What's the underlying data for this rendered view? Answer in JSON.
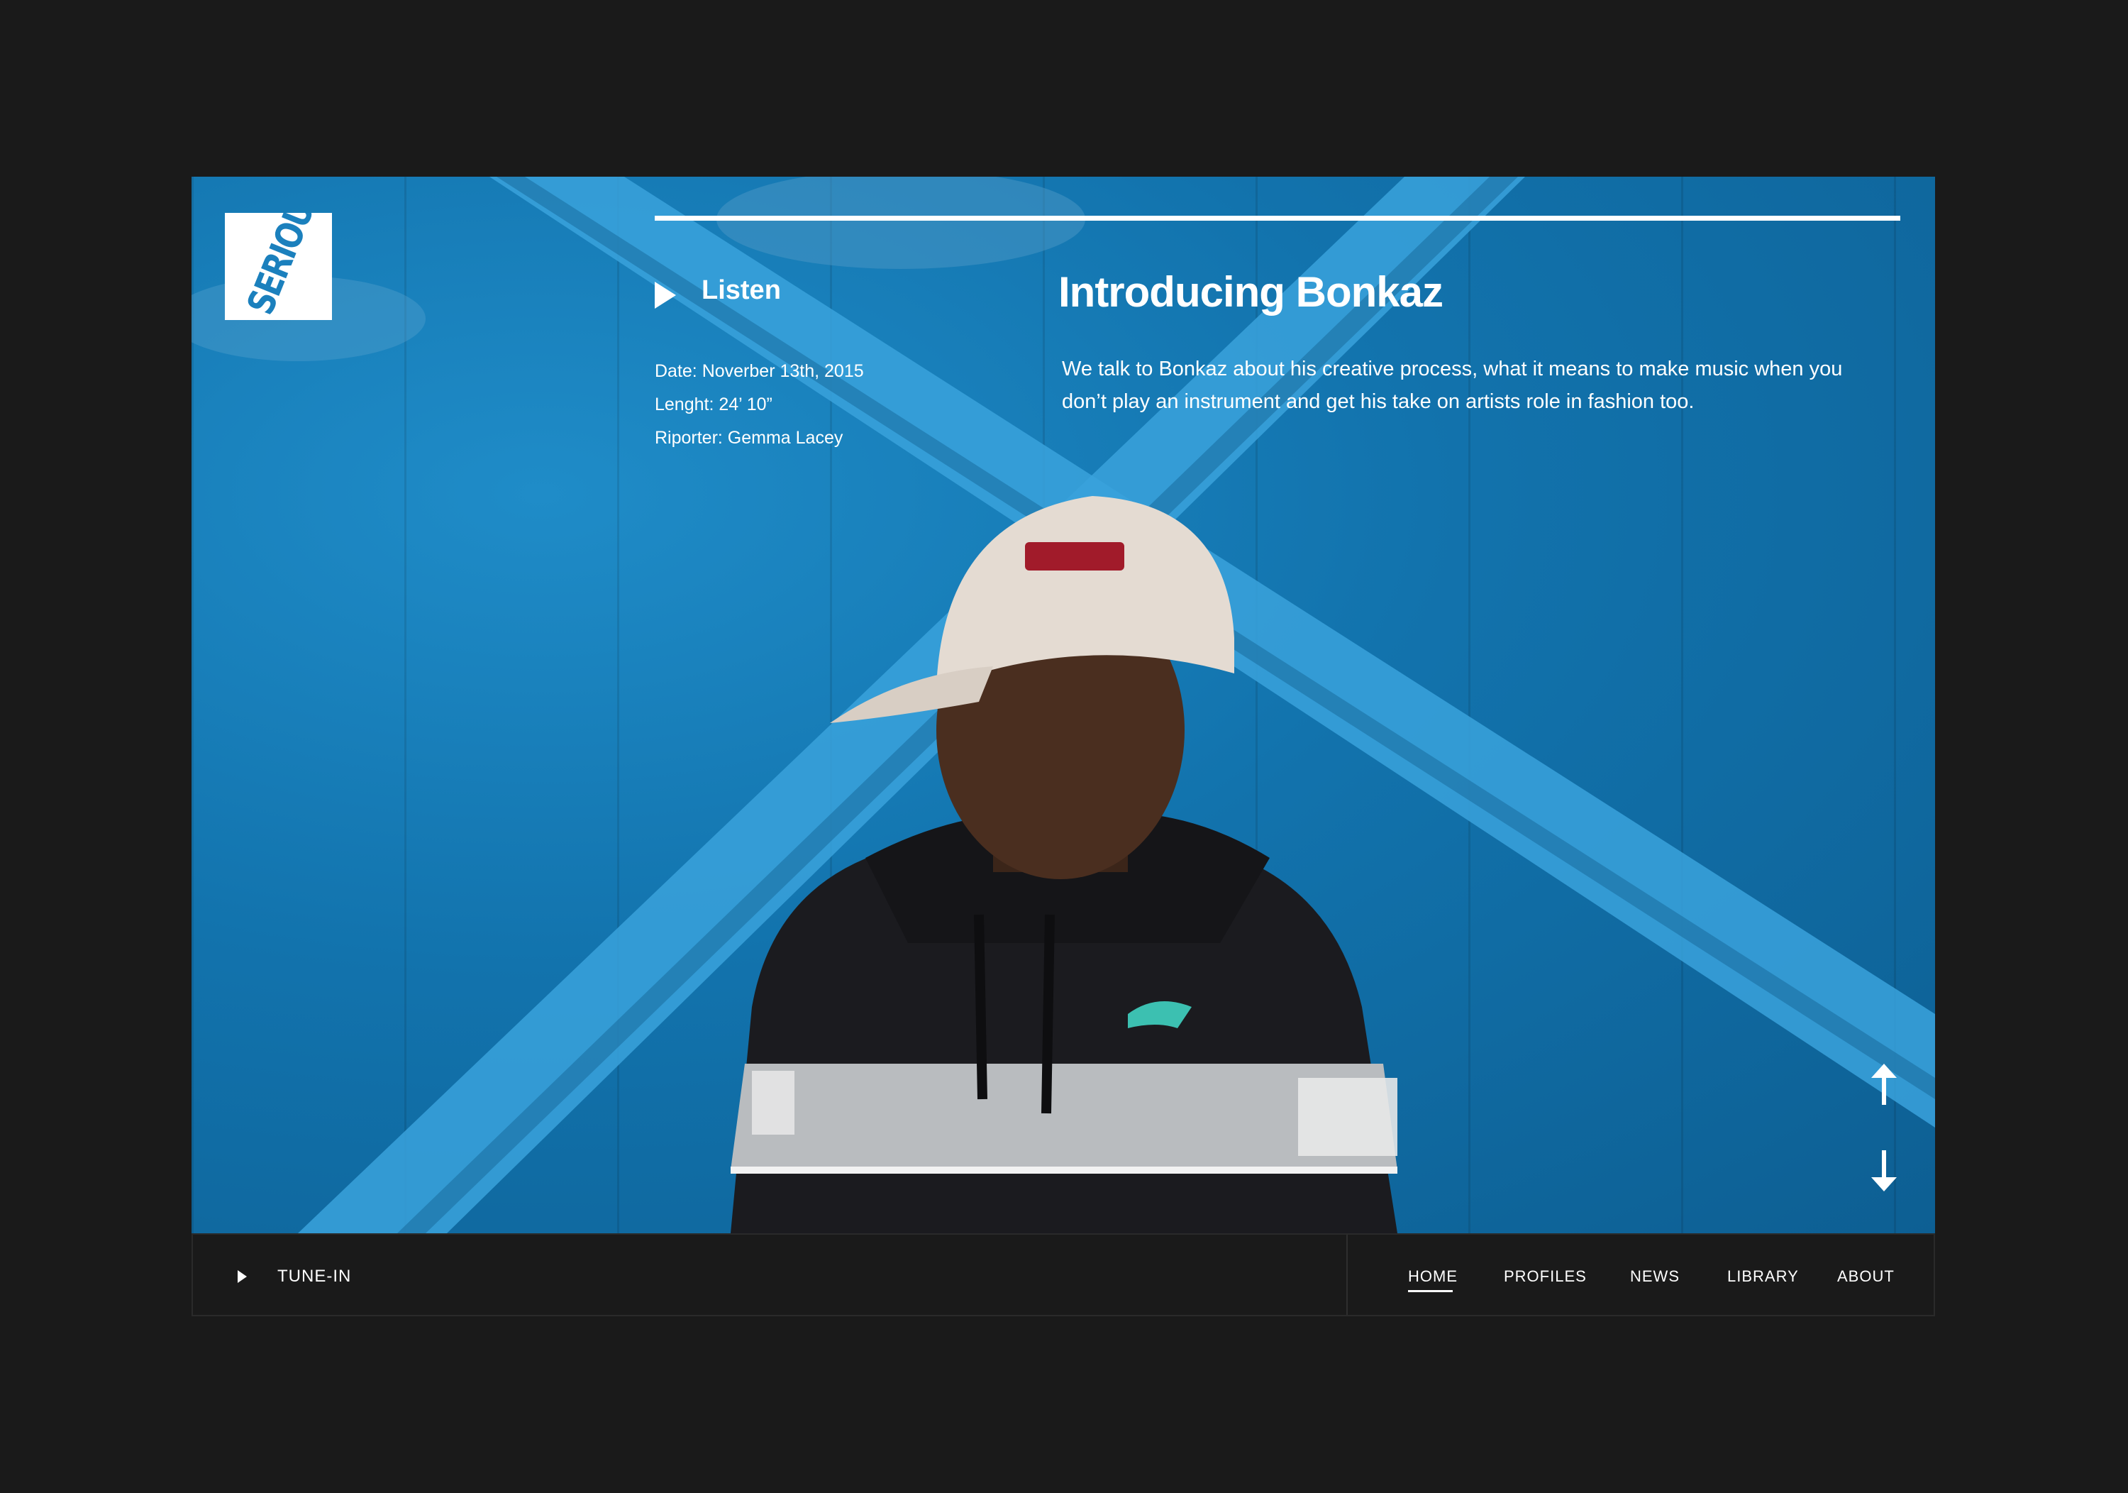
{
  "brand": {
    "logo_text": "SERIOUS",
    "accent_color": "#1b80bd",
    "background_color": "#1a1a1a"
  },
  "episode": {
    "listen_label": "Listen",
    "title": "Introducing Bonkaz",
    "description": "We talk to Bonkaz about his creative process, what it means to make music when you don’t play an instrument and get his take on artists role in fashion too.",
    "meta": {
      "date": "Date: Noverber 13th, 2015",
      "length": "Lenght: 24’ 10”",
      "reporter": "Riporter: Gemma Lacey"
    }
  },
  "controls": {
    "up_icon": "arrow-up-icon",
    "down_icon": "arrow-down-icon"
  },
  "footer": {
    "tune_in_label": "TUNE-IN",
    "nav": {
      "home": "HOME",
      "profiles": "PROFILES",
      "news": "NEWS",
      "library": "LIBRARY",
      "about": "ABOUT"
    },
    "active": "HOME"
  }
}
